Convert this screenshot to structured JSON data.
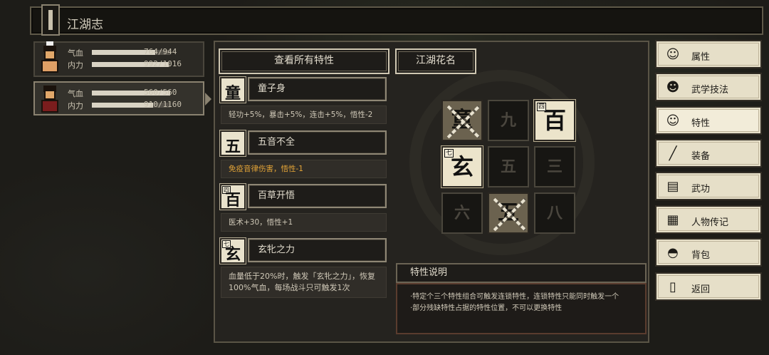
{
  "header": {
    "title": "江湖志"
  },
  "characters": [
    {
      "hp_label": "气血",
      "hp": "764/944",
      "hp_ratio": 0.81,
      "mp_label": "内力",
      "mp": "992/1016",
      "mp_ratio": 0.98,
      "active": false
    },
    {
      "hp_label": "气血",
      "hp": "560/560",
      "hp_ratio": 1.0,
      "mp_label": "内力",
      "mp": "910/1160",
      "mp_ratio": 0.78,
      "active": true
    }
  ],
  "panel": {
    "view_all_label": "查看所有特性",
    "nickname_label": "江湖花名",
    "traits": [
      {
        "icon_glyph": "童",
        "icon_num": "",
        "name": "童子身",
        "desc": "轻功+5%，暴击+5%，连击+5%，悟性-2",
        "desc_color": "#cfc8b7"
      },
      {
        "icon_glyph": "五",
        "icon_num": "",
        "name": "五音不全",
        "desc": "免疫音律伤害，悟性-1",
        "desc_color": "#e3a437"
      },
      {
        "icon_glyph": "百",
        "icon_num": "四",
        "name": "百草开悟",
        "desc": "医术+30，悟性+1",
        "desc_color": "#cfc8b7"
      },
      {
        "icon_glyph": "玄",
        "icon_num": "七",
        "name": "玄牝之力",
        "desc": "血量低于20%时，触发「玄牝之力」，恢复100%气血，每场战斗只可触发1次",
        "desc_color": "#cfc8b7"
      }
    ],
    "grid": [
      {
        "glyph": "童",
        "num": "",
        "state": "chained"
      },
      {
        "glyph": "九",
        "num": "",
        "state": "empty"
      },
      {
        "glyph": "百",
        "num": "四",
        "state": "lit"
      },
      {
        "glyph": "玄",
        "num": "七",
        "state": "lit"
      },
      {
        "glyph": "五",
        "num": "",
        "state": "empty"
      },
      {
        "glyph": "三",
        "num": "",
        "state": "empty"
      },
      {
        "glyph": "六",
        "num": "",
        "state": "empty"
      },
      {
        "glyph": "五",
        "num": "",
        "state": "chained"
      },
      {
        "glyph": "八",
        "num": "",
        "state": "empty"
      }
    ],
    "explain_title": "特性说明",
    "explain_lines": [
      "·特定个三个特性组合可触发连锁特性，连锁特性只能同时触发一个",
      "·部分残缺特性占据的特性位置，不可以更换特性"
    ]
  },
  "menu": [
    {
      "label": "属性",
      "icon": "person-icon",
      "glyph": "☺",
      "active": false
    },
    {
      "label": "武学技法",
      "icon": "martial-skill-icon",
      "glyph": "☻",
      "active": false
    },
    {
      "label": "特性",
      "icon": "trait-icon",
      "glyph": "☺",
      "active": true
    },
    {
      "label": "装备",
      "icon": "sword-icon",
      "glyph": "╱",
      "active": false
    },
    {
      "label": "武功",
      "icon": "book-icon",
      "glyph": "▤",
      "active": false
    },
    {
      "label": "人物传记",
      "icon": "scroll-icon",
      "glyph": "▦",
      "active": false
    },
    {
      "label": "背包",
      "icon": "bag-icon",
      "glyph": "◓",
      "active": false
    },
    {
      "label": "返回",
      "icon": "door-icon",
      "glyph": "▯",
      "active": false
    }
  ]
}
